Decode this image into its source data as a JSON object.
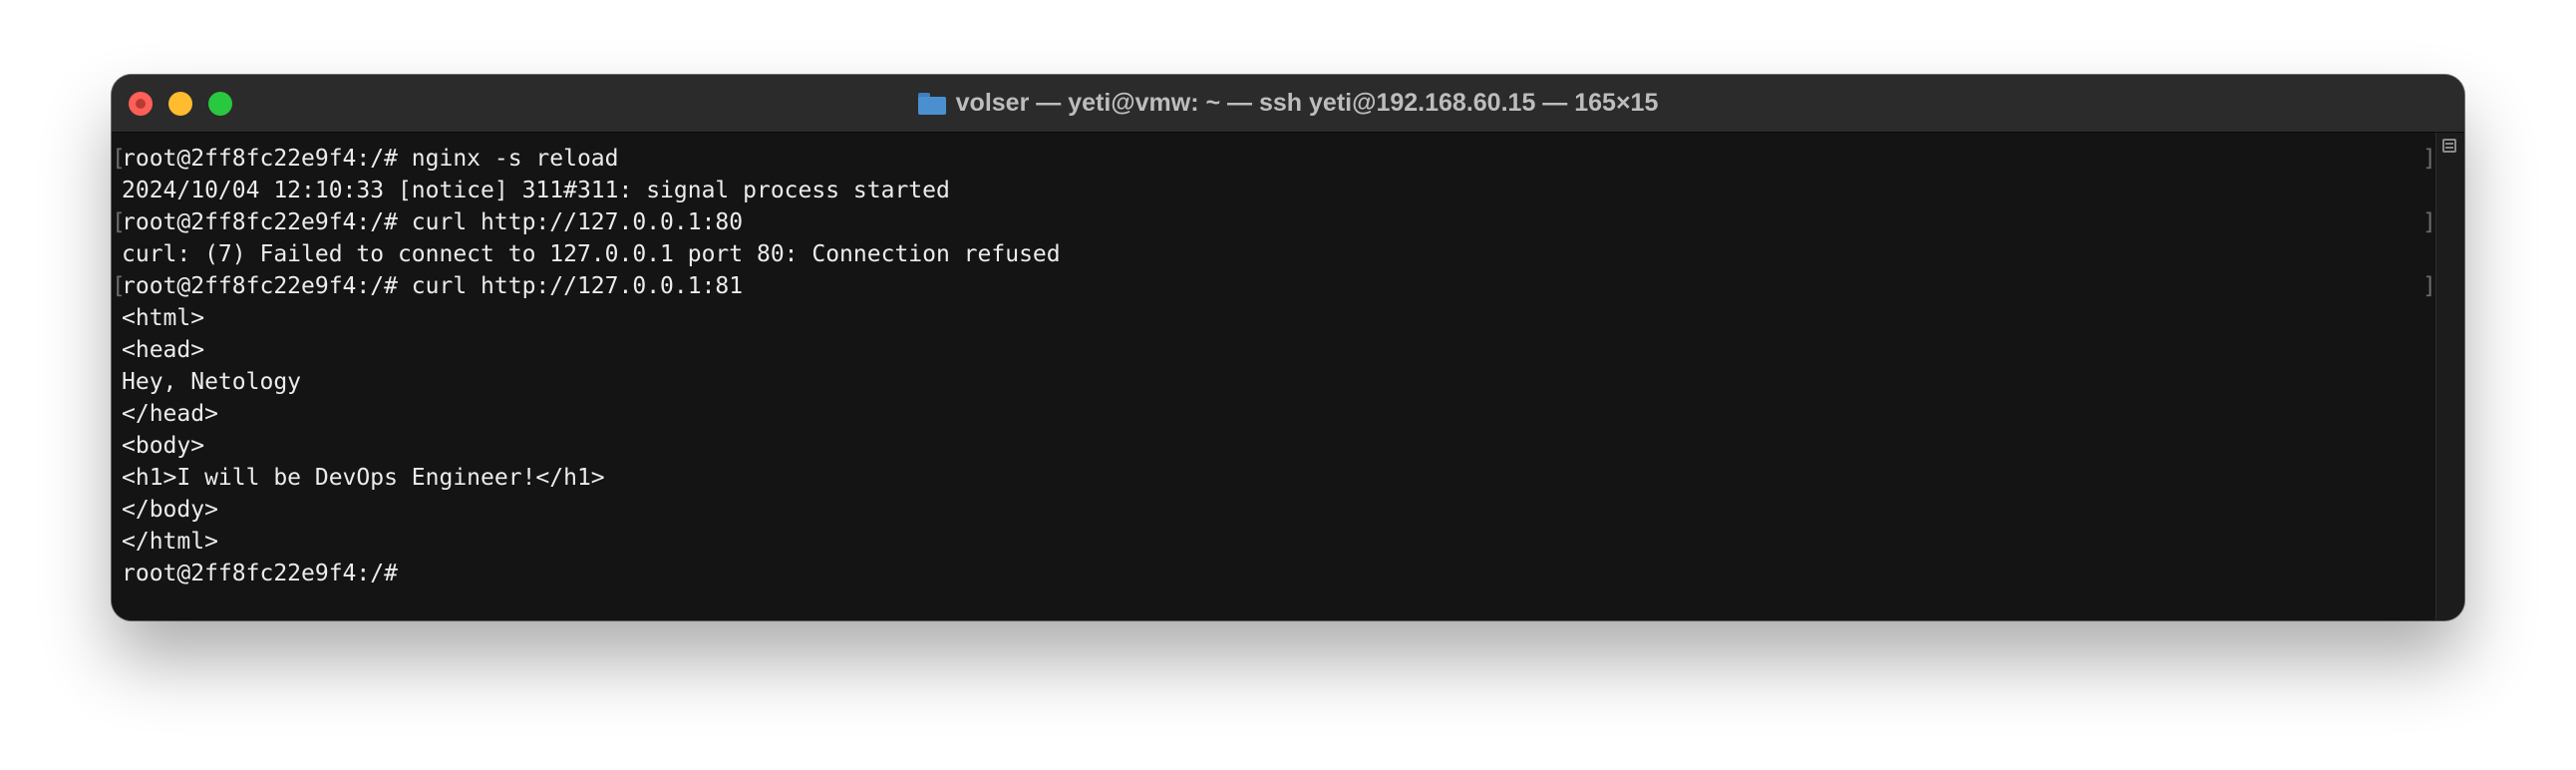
{
  "window": {
    "title": "volser — yeti@vmw: ~ — ssh yeti@192.168.60.15 — 165×15",
    "folder_icon": "folder-icon"
  },
  "terminal": {
    "lines": [
      "root@2ff8fc22e9f4:/# nginx -s reload",
      "2024/10/04 12:10:33 [notice] 311#311: signal process started",
      "root@2ff8fc22e9f4:/# curl http://127.0.0.1:80",
      "curl: (7) Failed to connect to 127.0.0.1 port 80: Connection refused",
      "root@2ff8fc22e9f4:/# curl http://127.0.0.1:81",
      "<html>",
      "<head>",
      "Hey, Netology",
      "</head>",
      "<body>",
      "<h1>I will be DevOps Engineer!</h1>",
      "</body>",
      "</html>",
      "root@2ff8fc22e9f4:/#"
    ]
  },
  "colors": {
    "background": "#141414",
    "titlebar": "#2b2b2b",
    "text": "#ececec",
    "close": "#fe5f57",
    "minimize": "#febc2e",
    "zoom": "#28c840"
  }
}
